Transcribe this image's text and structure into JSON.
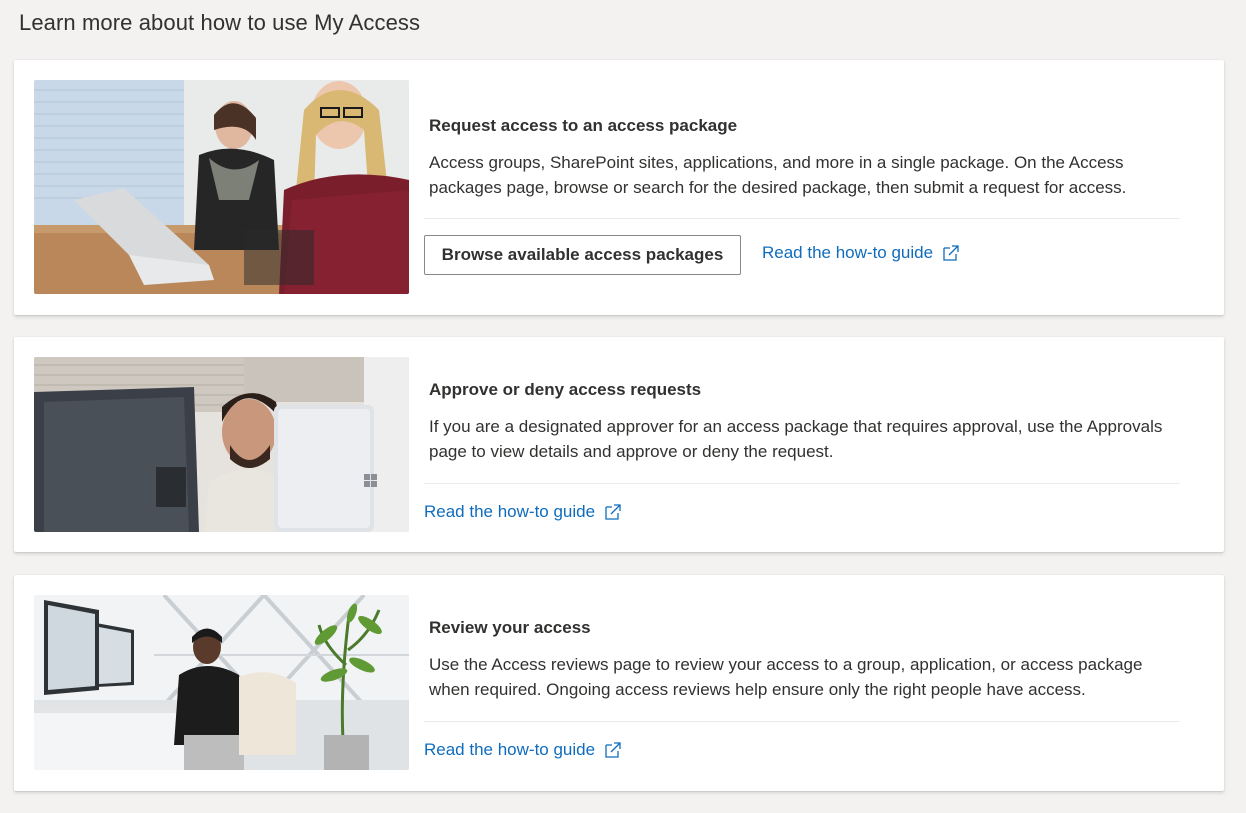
{
  "page": {
    "title": "Learn more about how to use My Access"
  },
  "cards": [
    {
      "title": "Request access to an access package",
      "description": "Access groups, SharePoint sites, applications, and more in a single package. On the Access packages page, browse or search for the desired package, then submit a request for access.",
      "button_label": "Browse available access packages",
      "link_label": "Read the how-to guide",
      "link_icon": "external-link-icon"
    },
    {
      "title": "Approve or deny access requests",
      "description": "If you are a designated approver for an access package that requires approval, use the Approvals page to view details and approve or deny the request.",
      "link_label": "Read the how-to guide",
      "link_icon": "external-link-icon"
    },
    {
      "title": "Review your access",
      "description": "Use the Access reviews page to review your access to a group, application, or access package when required. Ongoing access reviews help ensure only the right people have access.",
      "link_label": "Read the how-to guide",
      "link_icon": "external-link-icon"
    }
  ],
  "colors": {
    "background": "#f3f2f1",
    "card": "#ffffff",
    "text": "#323130",
    "link": "#0f6cbd",
    "divider": "#edebe9",
    "button_border": "#8a8886"
  }
}
